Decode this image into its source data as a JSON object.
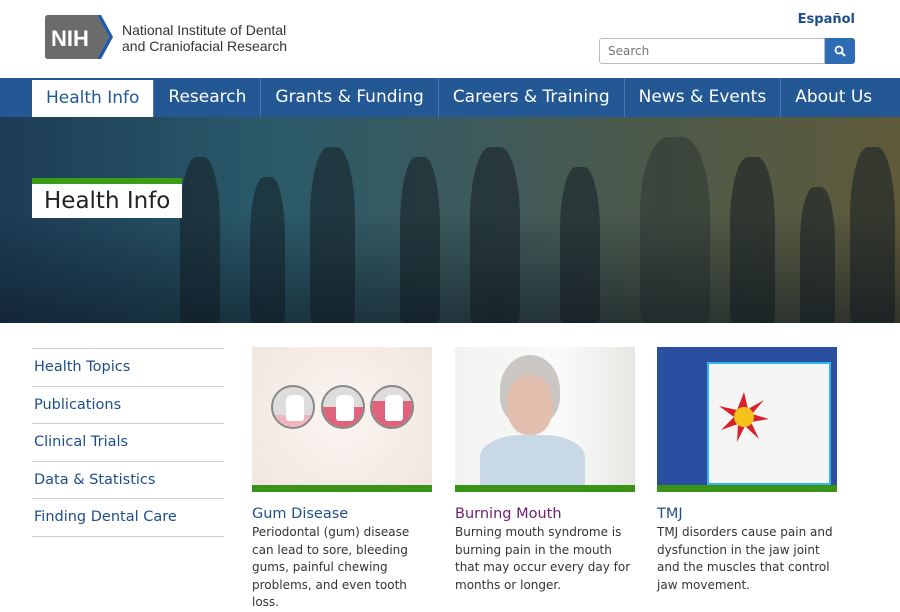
{
  "header": {
    "logo_text": "NIH",
    "org_line1": "National Institute of Dental",
    "org_line2": "and Craniofacial Research",
    "language_link": "Español",
    "search_placeholder": "Search",
    "search_icon": "magnifier-icon"
  },
  "nav": {
    "items": [
      {
        "label": "Health Info",
        "active": true
      },
      {
        "label": "Research"
      },
      {
        "label": "Grants & Funding"
      },
      {
        "label": "Careers & Training"
      },
      {
        "label": "News & Events"
      },
      {
        "label": "About Us"
      }
    ]
  },
  "hero": {
    "title": "Health Info"
  },
  "sidebar": {
    "items": [
      {
        "label": "Health Topics"
      },
      {
        "label": "Publications"
      },
      {
        "label": "Clinical Trials"
      },
      {
        "label": "Data & Statistics"
      },
      {
        "label": "Finding Dental Care"
      }
    ]
  },
  "cards": [
    {
      "title": "Gum Disease",
      "description": "Periodontal (gum) disease can lead to sore, bleeding gums, painful chewing problems, and even tooth loss.",
      "title_color": "#1e4e8c"
    },
    {
      "title": "Burning Mouth",
      "description": "Burning mouth syndrome is burning pain in the mouth that may occur every day for months or longer.",
      "title_color": "#6b1f6e"
    },
    {
      "title": "TMJ",
      "description": "TMJ disorders cause pain and dysfunction in the jaw joint and the muscles that control jaw movement.",
      "title_color": "#1e4e8c"
    }
  ],
  "colors": {
    "nav": "#235894",
    "accent_green": "#3a9216",
    "link": "#1e4e8c"
  }
}
